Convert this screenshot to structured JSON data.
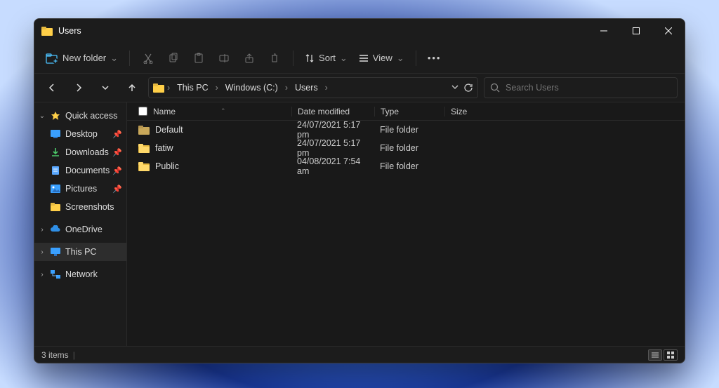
{
  "window": {
    "title": "Users"
  },
  "toolbar": {
    "new_label": "New folder",
    "sort_label": "Sort",
    "view_label": "View"
  },
  "breadcrumbs": [
    "This PC",
    "Windows (C:)",
    "Users"
  ],
  "search": {
    "placeholder": "Search Users"
  },
  "sidebar": {
    "quick_access": {
      "label": "Quick access",
      "items": [
        {
          "label": "Desktop",
          "icon": "desktop",
          "pinned": true
        },
        {
          "label": "Downloads",
          "icon": "downloads",
          "pinned": true
        },
        {
          "label": "Documents",
          "icon": "documents",
          "pinned": true
        },
        {
          "label": "Pictures",
          "icon": "pictures",
          "pinned": true
        },
        {
          "label": "Screenshots",
          "icon": "folder",
          "pinned": false
        }
      ]
    },
    "onedrive": {
      "label": "OneDrive"
    },
    "thispc": {
      "label": "This PC"
    },
    "network": {
      "label": "Network"
    }
  },
  "columns": {
    "name": "Name",
    "date": "Date modified",
    "type": "Type",
    "size": "Size"
  },
  "rows": [
    {
      "name": "Default",
      "date": "24/07/2021 5:17 pm",
      "type": "File folder",
      "open": false
    },
    {
      "name": "fatiw",
      "date": "24/07/2021 5:17 pm",
      "type": "File folder",
      "open": true
    },
    {
      "name": "Public",
      "date": "04/08/2021 7:54 am",
      "type": "File folder",
      "open": true
    }
  ],
  "status": {
    "count": "3 items"
  }
}
